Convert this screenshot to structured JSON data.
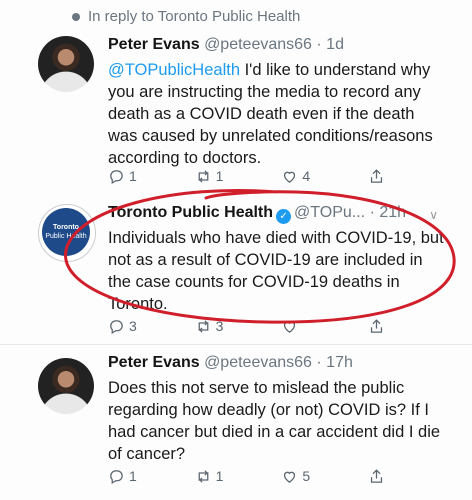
{
  "reply_context": "In reply to Toronto Public Health",
  "tweets": [
    {
      "name": "Peter Evans",
      "handle": "@peteevans66",
      "time": "· 1d",
      "mention": "@TOPublicHealth",
      "text": " I'd like to understand why you are instructing the media to record any death as a COVID death even if the death was caused by unrelated conditions/reasons according to doctors.",
      "replies": "1",
      "retweets": "1",
      "likes": "4"
    },
    {
      "name": "Toronto Public Health",
      "handle": "@TOPu...",
      "time": "· 21h",
      "text": "Individuals who have died with COVID-19, but not as a result of COVID-19 are included in the case counts for COVID-19 deaths in Toronto.",
      "replies": "3",
      "retweets": "3",
      "likes": "",
      "avatar_text": [
        "Toronto",
        "Public Health"
      ]
    },
    {
      "name": "Peter Evans",
      "handle": "@peteevans66",
      "time": "· 17h",
      "text": "Does this not serve to mislead the public regarding how deadly (or not) COVID is? If I had cancer but died in a car accident did I die of cancer?",
      "replies": "1",
      "retweets": "1",
      "likes": "5"
    }
  ],
  "colors": {
    "annotation": "#d01f2a",
    "link": "#1d9bf0",
    "muted": "#6b7680"
  },
  "icons": [
    "reply-icon",
    "retweet-icon",
    "like-icon",
    "share-icon",
    "verified-badge-icon",
    "chevron-down-icon"
  ]
}
